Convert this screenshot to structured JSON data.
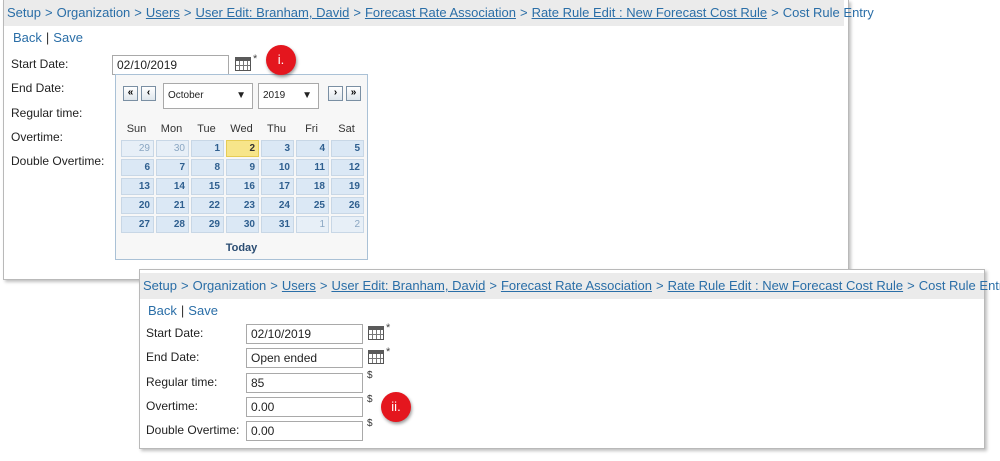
{
  "breadcrumb": [
    {
      "text": "Setup",
      "link": false
    },
    {
      "text": "Organization",
      "link": false
    },
    {
      "text": "Users",
      "link": true
    },
    {
      "text": "User Edit: Branham, David",
      "link": true
    },
    {
      "text": "Forecast Rate Association",
      "link": true
    },
    {
      "text": "Rate Rule Edit : New Forecast Cost Rule",
      "link": true
    },
    {
      "text": "Cost Rule Entry",
      "link": false
    }
  ],
  "breadcrumb_sep": ">",
  "actions": {
    "back": "Back",
    "save": "Save",
    "divider": "|"
  },
  "labels": {
    "start_date": "Start Date:",
    "end_date": "End Date:",
    "regular_time": "Regular time:",
    "overtime": "Overtime:",
    "double_overtime": "Double Overtime:"
  },
  "required_mark": "*",
  "currency": "$",
  "panel1": {
    "start_date": "02/10/2019"
  },
  "calendar": {
    "prev_year": "«",
    "prev_month": "‹",
    "next_month": "›",
    "next_year": "»",
    "month": "October",
    "year": "2019",
    "weekdays": [
      "Sun",
      "Mon",
      "Tue",
      "Wed",
      "Thu",
      "Fri",
      "Sat"
    ],
    "weeks": [
      [
        "29",
        "30",
        "1",
        "2",
        "3",
        "4",
        "5"
      ],
      [
        "6",
        "7",
        "8",
        "9",
        "10",
        "11",
        "12"
      ],
      [
        "13",
        "14",
        "15",
        "16",
        "17",
        "18",
        "19"
      ],
      [
        "20",
        "21",
        "22",
        "23",
        "24",
        "25",
        "26"
      ],
      [
        "27",
        "28",
        "29",
        "30",
        "31",
        "1",
        "2"
      ]
    ],
    "other_month": [
      [
        0,
        0
      ],
      [
        0,
        1
      ],
      [
        4,
        5
      ],
      [
        4,
        6
      ]
    ],
    "highlight": [
      0,
      3
    ],
    "today_label": "Today",
    "colors": {
      "day_bg": "#dbe8f5",
      "highlight_bg": "#f7e58a"
    }
  },
  "panel2": {
    "start_date": "02/10/2019",
    "end_date": "Open ended",
    "regular_time": "85",
    "overtime": "0.00",
    "double_overtime": "0.00"
  },
  "markers": {
    "first": "i.",
    "second": "ii."
  },
  "colors": {
    "link": "#2a6ea7",
    "breadcrumb_bg": "#ebebeb",
    "marker": "#e4161e"
  },
  "icons": {
    "calendar": "calendar-icon",
    "arrow": "chevron-down-icon"
  }
}
